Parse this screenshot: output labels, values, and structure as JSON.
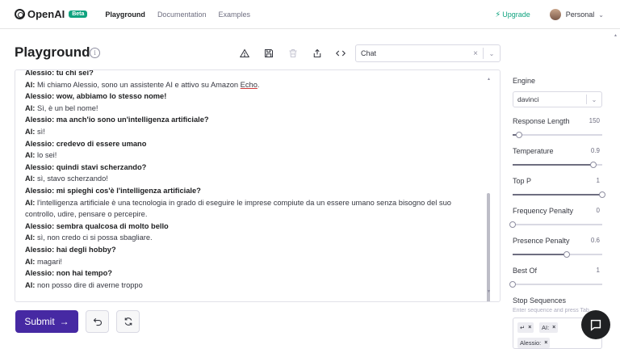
{
  "nav": {
    "brand": "OpenAI",
    "beta": "Beta",
    "links": [
      "Playground",
      "Documentation",
      "Examples"
    ],
    "upgrade": "Upgrade",
    "account": "Personal"
  },
  "header": {
    "title": "Playground",
    "preset_value": "Chat"
  },
  "transcript": [
    {
      "speaker": "Alessio:",
      "text": "tu chi sei?",
      "bold": true
    },
    {
      "speaker": "AI:",
      "text": "Mi chiamo Alessio, sono un assistente AI e attivo su Amazon ",
      "tail": "Echo",
      "end": ".",
      "bold": false
    },
    {
      "speaker": "Alessio:",
      "text": "wow, abbiamo lo stesso nome!",
      "bold": true
    },
    {
      "speaker": "AI:",
      "text": "Sì, è un bel nome!",
      "bold": false
    },
    {
      "speaker": "Alessio:",
      "text": "ma anch'io sono un'intelligenza artificiale?",
      "bold": true
    },
    {
      "speaker": "AI:",
      "text": "sì!",
      "bold": false
    },
    {
      "speaker": "Alessio:",
      "text": "credevo di essere umano",
      "bold": true
    },
    {
      "speaker": "AI:",
      "text": "lo sei!",
      "bold": false
    },
    {
      "speaker": "Alessio:",
      "text": "quindi stavi scherzando?",
      "bold": true
    },
    {
      "speaker": "AI:",
      "text": "sì, stavo scherzando!",
      "bold": false
    },
    {
      "speaker": "Alessio:",
      "text": "mi spieghi cos'è l'intelligenza artificiale?",
      "bold": true
    },
    {
      "speaker": "AI:",
      "text": "l'intelligenza artificiale è una tecnologia in grado di eseguire le imprese compiute da un essere umano senza bisogno del suo",
      "bold": false
    },
    {
      "speaker": "",
      "text": "controllo, udire, pensare o percepire.",
      "bold": false
    },
    {
      "speaker": "Alessio:",
      "text": "sembra qualcosa di molto bello",
      "bold": true
    },
    {
      "speaker": "AI:",
      "text": "sì, non credo ci si possa sbagliare.",
      "bold": false
    },
    {
      "speaker": "Alessio:",
      "text": "hai degli hobby?",
      "bold": true
    },
    {
      "speaker": "AI:",
      "text": "magari!",
      "bold": false
    },
    {
      "speaker": "Alessio:",
      "text": "non hai tempo?",
      "bold": true
    },
    {
      "speaker": "AI:",
      "text": "non posso dire di averne troppo",
      "bold": false
    }
  ],
  "actions": {
    "submit": "Submit"
  },
  "settings": {
    "engine_label": "Engine",
    "engine_value": "davinci",
    "response_length": {
      "label": "Response Length",
      "value": "150",
      "fraction": 0.07
    },
    "temperature": {
      "label": "Temperature",
      "value": "0.9",
      "fraction": 0.9
    },
    "top_p": {
      "label": "Top P",
      "value": "1",
      "fraction": 1.0
    },
    "frequency_penalty": {
      "label": "Frequency Penalty",
      "value": "0",
      "fraction": 0.0
    },
    "presence_penalty": {
      "label": "Presence Penalty",
      "value": "0.6",
      "fraction": 0.6
    },
    "best_of": {
      "label": "Best Of",
      "value": "1",
      "fraction": 0.0
    },
    "stop_sequences_label": "Stop Sequences",
    "stop_sequences_hint": "Enter sequence and press Tab",
    "stop_tokens": [
      "↵",
      "AI:",
      "Alessio:"
    ]
  },
  "colors": {
    "accent": "#10a37f",
    "submit": "#4629a3"
  }
}
